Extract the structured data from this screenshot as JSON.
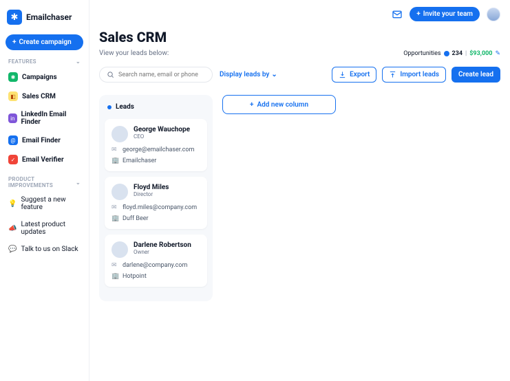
{
  "brand": "Emailchaser",
  "create_campaign": "Create campaign",
  "sections": {
    "features": "FEATURES",
    "improvements": "PRODUCT IMPROVEMENTS"
  },
  "nav": {
    "campaigns": "Campaigns",
    "sales_crm": "Sales CRM",
    "linkedin_finder": "LinkedIn Email Finder",
    "email_finder": "Email Finder",
    "email_verifier": "Email Verifier",
    "suggest": "Suggest a new feature",
    "updates": "Latest product updates",
    "slack": "Talk to us on Slack"
  },
  "topbar": {
    "invite": "Invite your team"
  },
  "page": {
    "title": "Sales CRM",
    "subtitle": "View your leads below:"
  },
  "opportunities": {
    "label": "Opportunities",
    "count": "234",
    "amount": "$93,000"
  },
  "search": {
    "placeholder": "Search name, email or phone"
  },
  "display_by": "Display leads by",
  "buttons": {
    "export": "Export",
    "import": "Import leads",
    "create_lead": "Create lead",
    "add_column": "Add new column"
  },
  "column": {
    "title": "Leads"
  },
  "leads": [
    {
      "name": "George Wauchope",
      "role": "CEO",
      "email": "george@emailchaser.com",
      "company": "Emailchaser"
    },
    {
      "name": "Floyd Miles",
      "role": "Director",
      "email": "floyd.miles@company.com",
      "company": "Duff Beer"
    },
    {
      "name": "Darlene Robertson",
      "role": "Owner",
      "email": "darlene@company.com",
      "company": "Hotpoint"
    }
  ]
}
